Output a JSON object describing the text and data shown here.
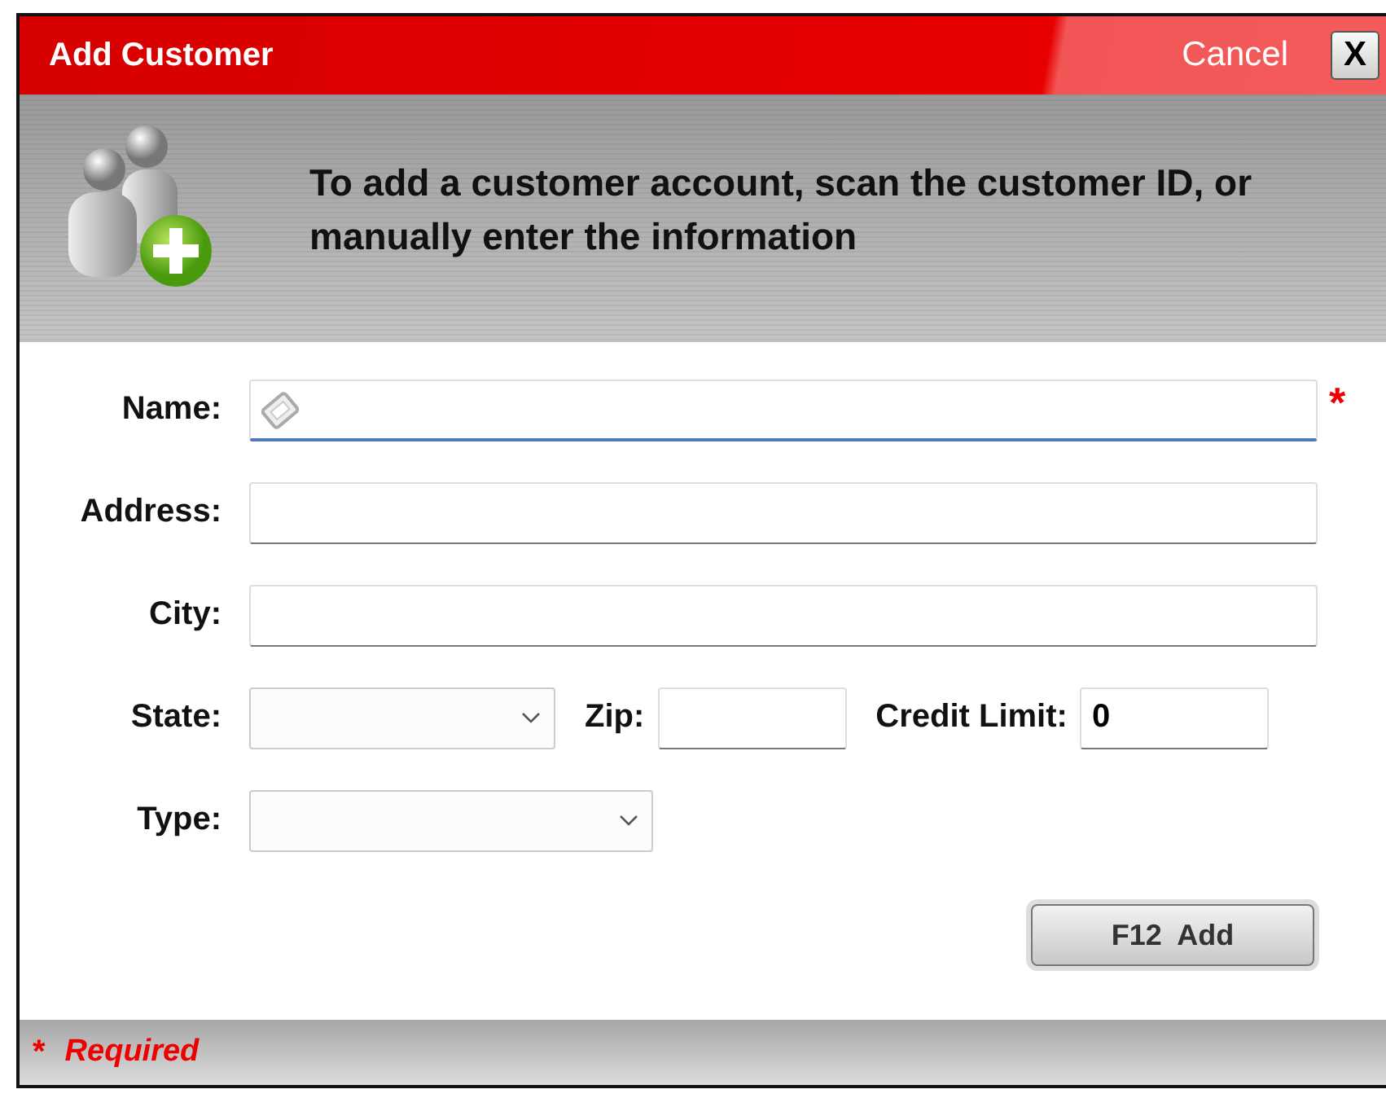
{
  "window": {
    "title": "Add Customer",
    "cancel": "Cancel",
    "close": "X"
  },
  "header": {
    "message": "To add a customer account, scan the customer ID, or manually enter the information"
  },
  "rows": [
    {
      "fields": [
        {
          "label": "Name:",
          "kind": "text",
          "focused": true,
          "required_mark": "*"
        }
      ]
    },
    {
      "fields": [
        {
          "label": "Address:",
          "kind": "text",
          "focused": false
        }
      ]
    },
    {
      "fields": [
        {
          "label": "City:",
          "kind": "text",
          "focused": false
        }
      ]
    },
    {
      "fields": [
        {
          "label": "State:",
          "kind": "select",
          "focused": false
        },
        {
          "label": "Zip:",
          "kind": "text",
          "focused": false
        },
        {
          "label": "Credit Limit:",
          "kind": "text",
          "value": "0",
          "focused": false
        }
      ]
    },
    {
      "fields": [
        {
          "label": "Type:",
          "kind": "select",
          "focused": false
        }
      ]
    }
  ],
  "add_button": "F12  Add",
  "footer": {
    "mark": "*",
    "text": "Required"
  }
}
